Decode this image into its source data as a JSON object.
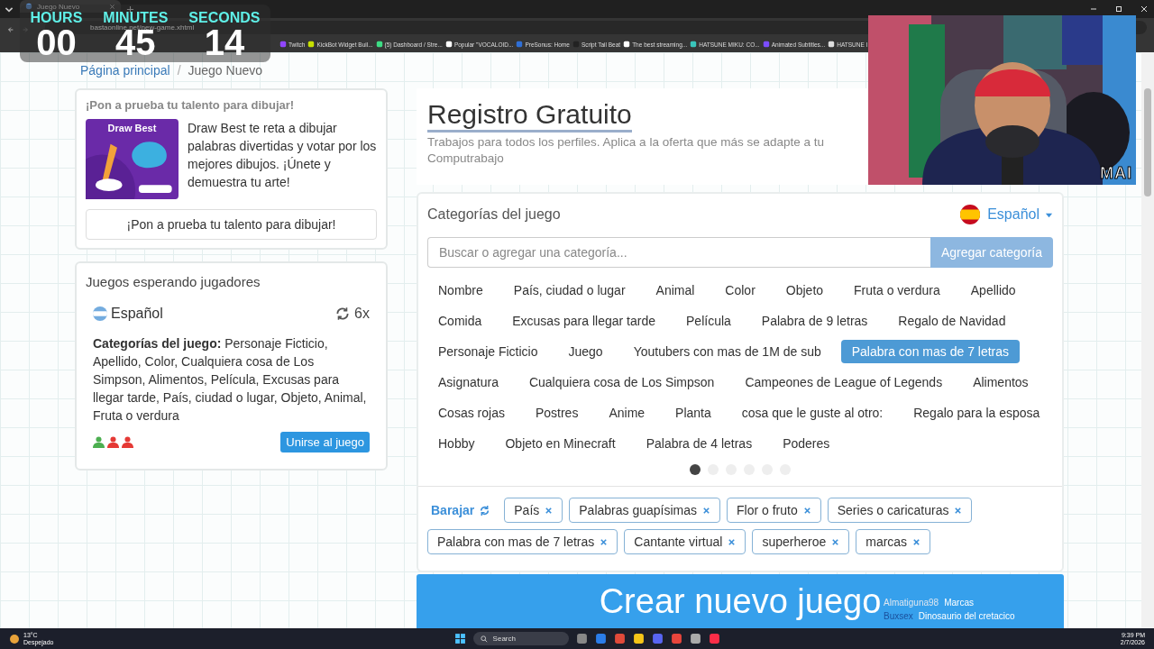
{
  "browser": {
    "tab_title": "Juego Nuevo",
    "url": "bastaonline.net/new-game.xhtml",
    "bookmarks": [
      "Twitch",
      "KickBot Widget Buil...",
      "(5) Dashboard / Stre...",
      "Popular \"VOCALOID...",
      "PreSonus: Home",
      "Script Tail Beat",
      "The best streaming...",
      "HATSUNE MIKU: CO...",
      "Animated Subtitles...",
      "HATSUNE I"
    ]
  },
  "timer": {
    "units": [
      {
        "label": "HOURS",
        "value": "00"
      },
      {
        "label": "MINUTES",
        "value": "45"
      },
      {
        "label": "SECONDS",
        "value": "14"
      }
    ]
  },
  "webcam": {
    "kind": "picture",
    "badge": "MAI"
  },
  "breadcrumb": {
    "items": [
      "Página principal",
      "Juego Nuevo"
    ],
    "separator": "/"
  },
  "promo": {
    "title": "¡Pon a prueba tu talento para dibujar!",
    "art_title": "Draw Best",
    "description": "Draw Best te reta a dibujar palabras divertidas y votar por los mejores dibujos. ¡Únete y demuestra tu arte!",
    "button": "¡Pon a prueba tu talento para dibujar!"
  },
  "waiting": {
    "title": "Juegos esperando jugadores",
    "language": "Español",
    "rounds": "6x",
    "categories": "**Categorías del juego:** Personaje Ficticio, Apellido, Color, Cualquiera cosa de Los Simpson, Alimentos, Película, Excusas para llegar tarde, País, ciudad o lugar, Objeto, Animal, Fruta o verdura",
    "players": [
      {
        "color": "#4caf50"
      },
      {
        "color": "#e53935"
      },
      {
        "color": "#e53935"
      }
    ],
    "join_button": "Unirse al juego"
  },
  "registration": {
    "title": "Registro Gratuito",
    "subtitle_lines": [
      "Trabajos para todos los perfiles. Aplica a la oferta que más se adapte a tu",
      "Computrabajo"
    ]
  },
  "categories": {
    "title": "Categorías del juego",
    "language": "Español",
    "search_placeholder": "Buscar o agregar una categoría...",
    "add_button": "Agregar categoría",
    "items": [
      {
        "label": "Nombre",
        "selected": false
      },
      {
        "label": "País, ciudad o lugar",
        "selected": false
      },
      {
        "label": "Animal",
        "selected": false
      },
      {
        "label": "Color",
        "selected": false
      },
      {
        "label": "Objeto",
        "selected": false
      },
      {
        "label": "Fruta o verdura",
        "selected": false
      },
      {
        "label": "Apellido",
        "selected": false
      },
      {
        "label": "Comida",
        "selected": false
      },
      {
        "label": "Excusas para llegar tarde",
        "selected": false
      },
      {
        "label": "Película",
        "selected": false
      },
      {
        "label": "Palabra de 9 letras",
        "selected": false
      },
      {
        "label": "Regalo de Navidad",
        "selected": false
      },
      {
        "label": "Personaje Ficticio",
        "selected": false
      },
      {
        "label": "Juego",
        "selected": false
      },
      {
        "label": "Youtubers con mas de 1M de sub",
        "selected": false
      },
      {
        "label": "Palabra con mas de 7 letras",
        "selected": true
      },
      {
        "label": "Asignatura",
        "selected": false
      },
      {
        "label": "Cualquiera cosa de Los Simpson",
        "selected": false
      },
      {
        "label": "Campeones de League of Legends",
        "selected": false
      },
      {
        "label": "Alimentos",
        "selected": false
      },
      {
        "label": "Cosas rojas",
        "selected": false
      },
      {
        "label": "Postres",
        "selected": false
      },
      {
        "label": "Anime",
        "selected": false
      },
      {
        "label": "Planta",
        "selected": false
      },
      {
        "label": "cosa que le guste al otro:",
        "selected": false
      },
      {
        "label": "Regalo para la esposa",
        "selected": false
      },
      {
        "label": "Hobby",
        "selected": false
      },
      {
        "label": "Objeto en Minecraft",
        "selected": false
      },
      {
        "label": "Palabra de 4 letras",
        "selected": false
      },
      {
        "label": "Poderes",
        "selected": false
      }
    ],
    "pages": [
      {
        "selected": true
      },
      {
        "selected": false
      },
      {
        "selected": false
      },
      {
        "selected": false
      },
      {
        "selected": false
      },
      {
        "selected": false
      }
    ],
    "shuffle": "Barajar",
    "chosen": [
      "País",
      "Palabras guapísimas",
      "Flor o fruto",
      "Series o caricaturas",
      "Palabra con mas de 7 letras",
      "Cantante virtual",
      "superheroe",
      "marcas"
    ]
  },
  "create_button": "Crear nuevo juego",
  "chat": [
    {
      "user": "Almatiguna98",
      "message": "Marcas"
    },
    {
      "user": "Buxsex",
      "message": "Dinosaurio del cretacico"
    }
  ],
  "taskbar": {
    "temperature": "13°C",
    "weather": "Despejado",
    "search": "Search",
    "time": "9:39 PM",
    "date": "2/7/2026"
  }
}
